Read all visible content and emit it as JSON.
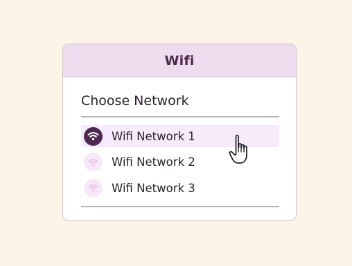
{
  "dialog": {
    "title": "Wifi",
    "section_title": "Choose Network",
    "networks": [
      {
        "label": "Wifi Network 1",
        "icon": "wifi-icon",
        "selected": true
      },
      {
        "label": "Wifi Network 2",
        "icon": "wifi-icon",
        "selected": false
      },
      {
        "label": "Wifi Network 3",
        "icon": "wifi-icon",
        "selected": false
      }
    ]
  },
  "cursor": {
    "icon": "hand-pointer-icon"
  },
  "colors": {
    "background": "#fdf3e7",
    "header": "#ecdcee",
    "accent": "#4e2a52",
    "selected_row": "#f6ebfb",
    "icon_weak_bg": "#f6e8f6",
    "icon_weak_fg": "#e6b7e4"
  }
}
